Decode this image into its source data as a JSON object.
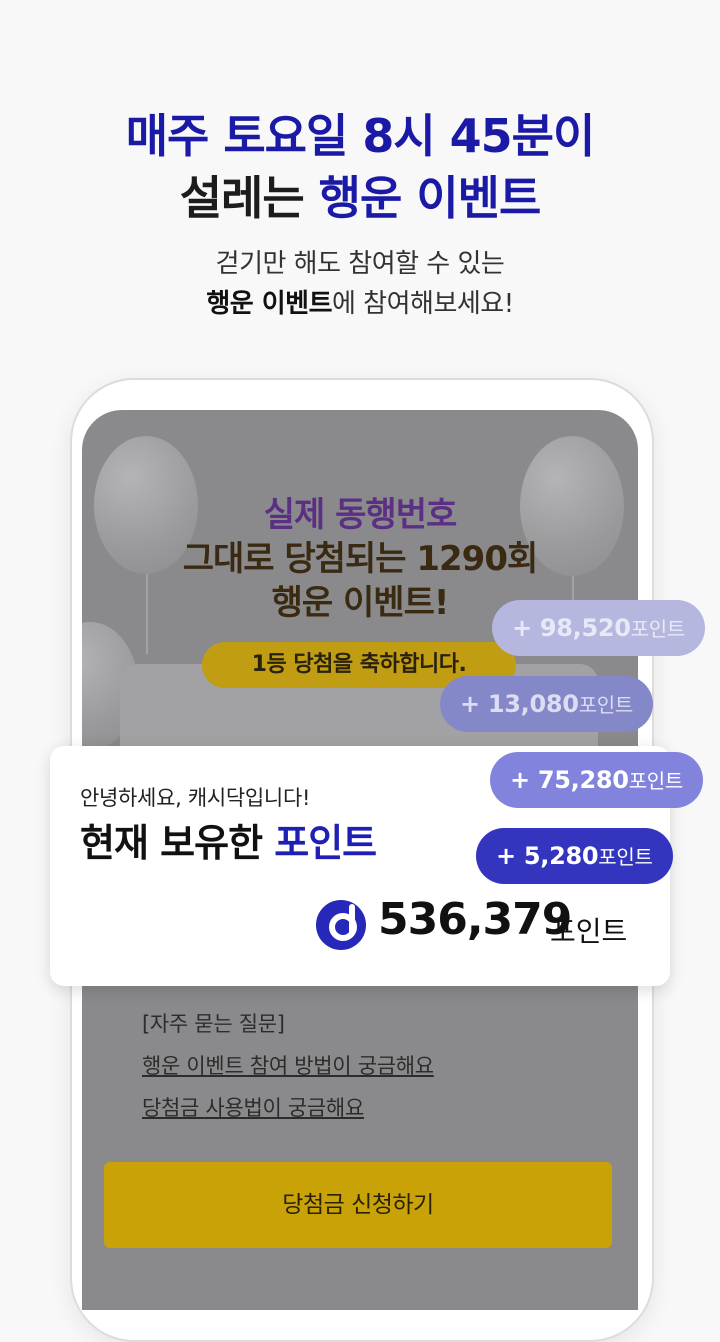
{
  "headline": {
    "line1": "매주 토요일 8시 45분이",
    "line2_part1": "설레는 ",
    "line2_part2": "행운 이벤트"
  },
  "subtitle": {
    "line1": "걷기만 해도 참여할 수 있는",
    "line2_bold": "행운 이벤트",
    "line2_rest": "에 참여해보세요!"
  },
  "event": {
    "title1": "실제 동행번호",
    "title2": "그대로 당첨되는 1290회",
    "title3": "행운 이벤트!",
    "congrats": "1등 당첨을 축하합니다."
  },
  "points_pills": [
    {
      "amount": "+ 98,520",
      "unit": "포인트"
    },
    {
      "amount": "+ 13,080",
      "unit": "포인트"
    },
    {
      "amount": "+ 75,280",
      "unit": "포인트"
    },
    {
      "amount": "+ 5,280",
      "unit": "포인트"
    }
  ],
  "card": {
    "greeting": "안녕하세요, 캐시닥입니다!",
    "title_part1": "현재 보유한 ",
    "title_part2": "포인트",
    "balance": "536,379",
    "balance_unit": "포인트"
  },
  "faq": {
    "heading": "[자주 묻는 질문]",
    "link1": "행운 이벤트 참여 방법이 궁금해요",
    "link2": "당첨금 사용법이 궁금해요"
  },
  "claim_button": "당첨금 신청하기",
  "colors": {
    "brand_blue": "#1a1aa6",
    "gold": "#c9a207",
    "purple_title": "#5b2f83"
  }
}
